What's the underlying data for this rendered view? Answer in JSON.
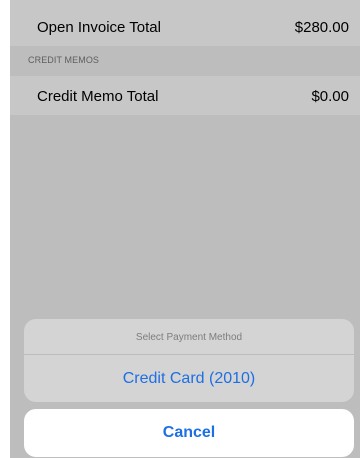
{
  "invoices": {
    "open_total_label": "Open Invoice Total",
    "open_total_value": "$280.00"
  },
  "credit_memos": {
    "section_header": "CREDIT MEMOS",
    "total_label": "Credit Memo Total",
    "total_value": "$0.00"
  },
  "action_sheet": {
    "title": "Select Payment Method",
    "options": [
      {
        "label": "Credit Card (2010)"
      }
    ],
    "cancel_label": "Cancel"
  },
  "colors": {
    "accent": "#1d6fe4",
    "dim_background": "#bdbdbd"
  }
}
